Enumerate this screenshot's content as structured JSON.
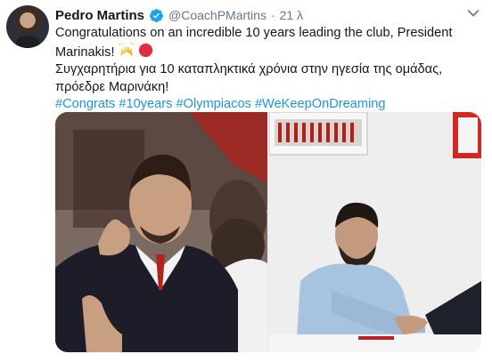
{
  "tweet": {
    "author_name": "Pedro Martins",
    "handle": "@CoachPMartins",
    "separator": "·",
    "time": "21 λ",
    "text_en_1": "Congratulations on an incredible 10 years leading the club, President",
    "text_en_2": "Marinakis!",
    "text_el_1": "Συγχαρητήρια για 10 καταπληκτικά χρόνια στην ηγεσία της ομάδας,",
    "text_el_2": "πρόεδρε Μαρινάκη!",
    "hashtags": [
      "#Congrats",
      "#10years",
      "#Olympiacos",
      "#WeKeepOnDreaming"
    ]
  },
  "icons": {
    "verified": "verified-badge-icon",
    "caret": "chevron-down-icon",
    "emoji_1": "raising-hands-emoji",
    "emoji_2": "red-circle-emoji"
  },
  "colors": {
    "link": "#1b95e0",
    "secondary_text": "#657786",
    "verified": "#1da1f2"
  },
  "media": {
    "photo_count": 2
  }
}
